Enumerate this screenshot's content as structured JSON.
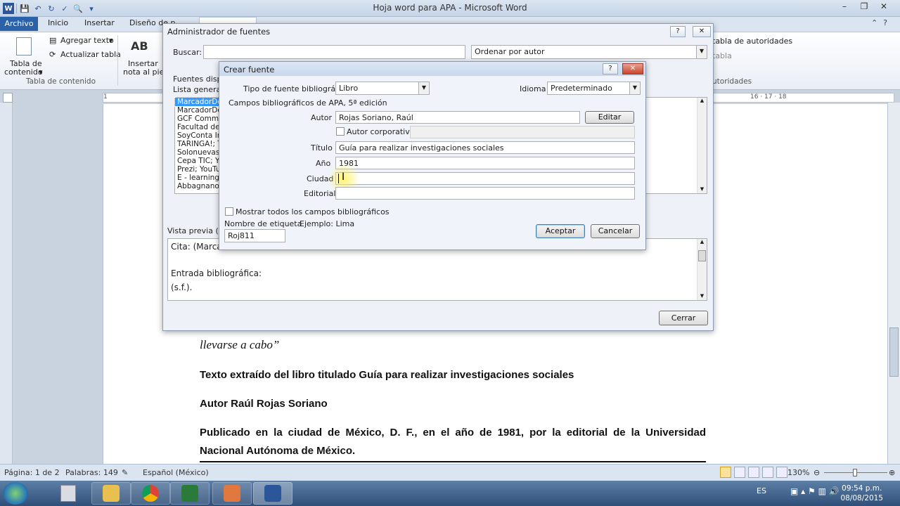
{
  "app": {
    "title": "Hoja word para APA - Microsoft Word"
  },
  "ribbon": {
    "tabs": [
      "Archivo",
      "Inicio",
      "Insertar",
      "Diseño de p"
    ],
    "agregar_texto": "Agregar texto",
    "actualizar_tabla": "Actualizar tabla",
    "tabla_contenido": "Tabla de",
    "tabla_contenido2": "contenido",
    "insertar": "Insertar",
    "nota_pie": "nota al pie",
    "ab_icon": "AB",
    "group_tabla": "Tabla de contenido",
    "tabla_autoridades": "tabla de autoridades",
    "tabla_short": "tabla",
    "autoridades": "utoridades"
  },
  "ruler": {
    "nums_left": "1",
    "nums_right": "16 · 17 · 18"
  },
  "admin": {
    "title": "Administrador de fuentes",
    "buscar_label": "Buscar:",
    "buscar_value": "",
    "ordenar": "Ordenar por autor",
    "fuentes_label": "Fuentes disp",
    "lista_general": "Lista general",
    "sources": [
      "MarcadorDeP",
      "MarcadorDeP",
      "GCF Commun",
      "Facultad de C",
      "SoyConta Inn",
      "TARINGA!; T",
      "Solonuevas.b",
      "Cepa TIC; Yo",
      "Prezi; YouTub",
      "E - learning U",
      "Abbagnano,"
    ],
    "preview_label": "Vista previa (AP",
    "preview_cita": "Cita:  (Marca",
    "preview_entrada": "Entrada bibliográfica:",
    "preview_sf": "(s.f.).",
    "cerrar": "Cerrar"
  },
  "crear": {
    "title": "Crear fuente",
    "tipo_label": "Tipo de fuente bibliográfica",
    "tipo_value": "Libro",
    "idioma_label": "Idioma",
    "idioma_value": "Predeterminado",
    "campos_label": "Campos bibliográficos de APA, 5ª edición",
    "autor_label": "Autor",
    "autor_value": "Rojas Soriano, Raúl",
    "editar": "Editar",
    "autor_corp": "Autor corporativo",
    "titulo_label": "Título",
    "titulo_value": "Guía para realizar investigaciones sociales",
    "anio_label": "Año",
    "anio_value": "1981",
    "ciudad_label": "Ciudad",
    "ciudad_value": "",
    "editorial_label": "Editorial",
    "editorial_value": "",
    "mostrar": "Mostrar todos los campos bibliográficos",
    "nombre_etiqueta": "Nombre de etiqueta",
    "ejemplo": "Ejemplo: Lima",
    "etiqueta_value": "Roj811",
    "aceptar": "Aceptar",
    "cancelar": "Cancelar"
  },
  "document": {
    "quote_end": "llevarse a cabo”",
    "p1": "Texto extraído del libro titulado Guía para realizar investigaciones sociales",
    "p2": "Autor Raúl Rojas Soriano",
    "p3a": "Publicado en la ciudad de México, D. F., en el año de 1981, por la editorial de la Universidad",
    "p3b": "Nacional Autónoma de México."
  },
  "status": {
    "pagina": "Página: 1 de 2",
    "palabras": "Palabras: 149",
    "idioma": "Español (México)",
    "zoom": "130%"
  },
  "taskbar": {
    "lang": "ES",
    "time": "09:54 p.m.",
    "date": "08/08/2015"
  }
}
